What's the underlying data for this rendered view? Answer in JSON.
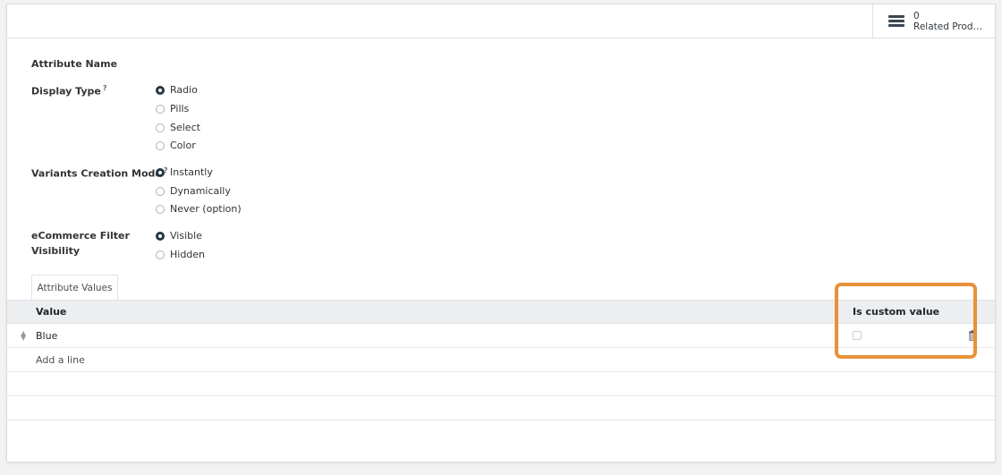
{
  "smart_button": {
    "count": "0",
    "label": "Related Produ..."
  },
  "form": {
    "attribute_name_label": "Attribute Name",
    "display_type": {
      "label": "Display Type",
      "help": "?",
      "options": [
        "Radio",
        "Pills",
        "Select",
        "Color"
      ],
      "selected": "Radio"
    },
    "variants_creation_mode": {
      "label": "Variants Creation Mode",
      "help": "?",
      "options": [
        "Instantly",
        "Dynamically",
        "Never (option)"
      ],
      "selected": "Instantly"
    },
    "ecommerce_filter": {
      "label_line1": "eCommerce Filter",
      "label_line2": "Visibility",
      "options": [
        "Visible",
        "Hidden"
      ],
      "selected": "Visible"
    }
  },
  "tab": {
    "label": "Attribute Values"
  },
  "table": {
    "columns": {
      "value": "Value",
      "is_custom": "Is custom value"
    },
    "rows": [
      {
        "value": "Blue",
        "is_custom": false
      }
    ],
    "add_line": "Add a line"
  },
  "colors": {
    "highlight": "#e8913a",
    "radio_checked": "#243742"
  }
}
